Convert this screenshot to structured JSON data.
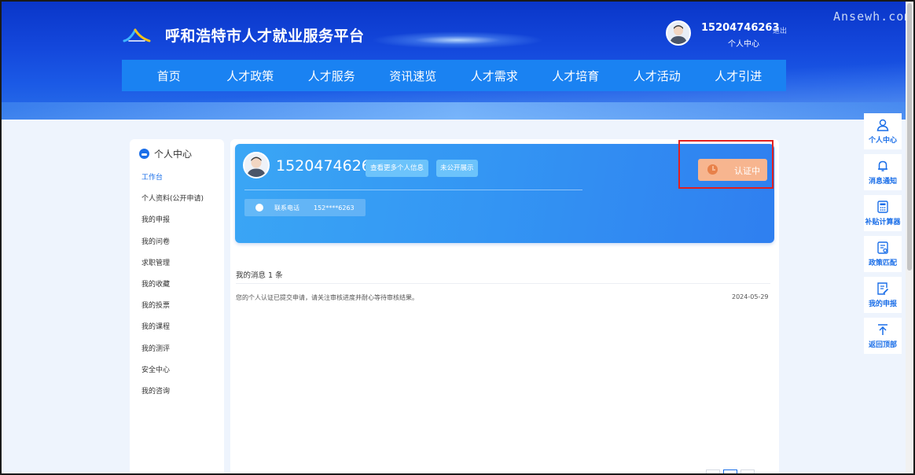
{
  "header": {
    "site_title": "呼和浩特市人才就业服务平台",
    "user_phone": "15204746263",
    "user_center": "个人中心",
    "logout": "退出",
    "watermark": "Ansewh.com"
  },
  "nav": {
    "items": [
      "首页",
      "人才政策",
      "人才服务",
      "资讯速览",
      "人才需求",
      "人才培育",
      "人才活动",
      "人才引进"
    ]
  },
  "sidebar": {
    "title": "个人中心",
    "items": [
      {
        "label": "工作台",
        "active": true
      },
      {
        "label": "个人资料(公开申请)"
      },
      {
        "label": "我的申报"
      },
      {
        "label": "我的问卷"
      },
      {
        "label": "求职管理"
      },
      {
        "label": "我的收藏"
      },
      {
        "label": "我的投票"
      },
      {
        "label": "我的课程"
      },
      {
        "label": "我的测评"
      },
      {
        "label": "安全中心"
      },
      {
        "label": "我的咨询"
      }
    ]
  },
  "profile": {
    "phone": "15204746263",
    "more_info_button": "查看更多个人信息",
    "privacy_button": "未公开展示",
    "contact_label": "联系电话",
    "contact_value": "152****6263",
    "verify_status": "认证中"
  },
  "messages": {
    "title": "我的消息 1 条",
    "items": [
      {
        "text": "您的个人认证已提交申请，请关注审核进度并耐心等待审核结果。",
        "date": "2024-05-29"
      }
    ]
  },
  "side_tools": [
    {
      "label": "个人中心",
      "icon": "user-icon"
    },
    {
      "label": "消息通知",
      "icon": "bell-icon"
    },
    {
      "label": "补贴计算器",
      "icon": "calculator-icon"
    },
    {
      "label": "政策匹配",
      "icon": "policy-match-icon"
    },
    {
      "label": "我的申报",
      "icon": "edit-doc-icon"
    },
    {
      "label": "返回顶部",
      "icon": "arrow-up-icon"
    }
  ],
  "colors": {
    "nav_bg": "#1a82f2",
    "accent": "#1a6ee8",
    "verify_bg": "#f7b58f",
    "highlight": "#e02020"
  }
}
